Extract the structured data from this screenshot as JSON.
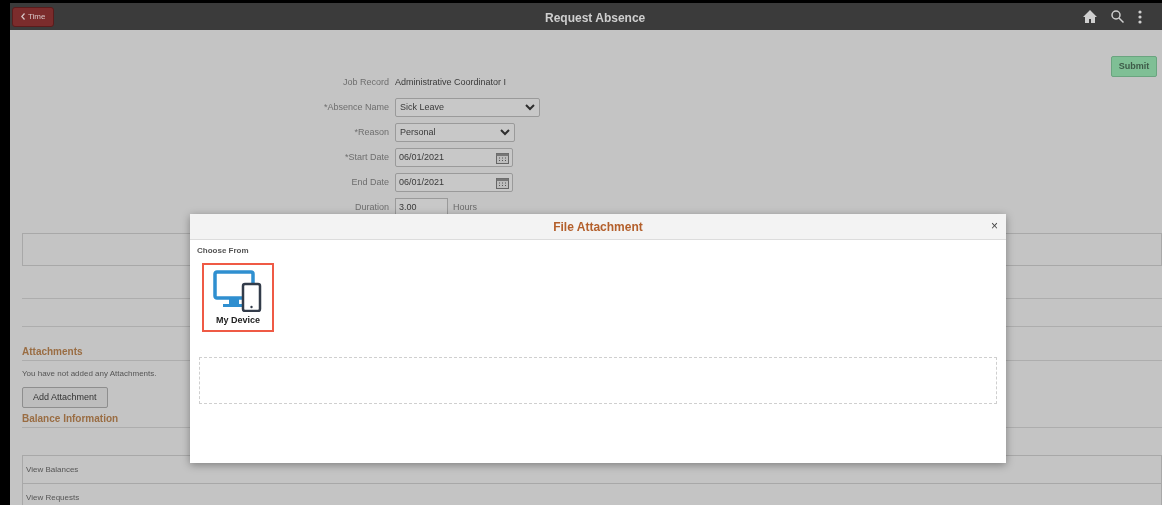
{
  "header": {
    "back_button": "Time",
    "title": "Request Absence"
  },
  "submit_button": "Submit",
  "form": {
    "fields": [
      {
        "label": "Job Record",
        "kind": "text",
        "value": "Administrative Coordinator I"
      },
      {
        "label": "*Absence Name",
        "kind": "select",
        "value": "Sick Leave"
      },
      {
        "label": "*Reason",
        "kind": "select",
        "value": "Personal"
      },
      {
        "label": "*Start Date",
        "kind": "date",
        "value": "06/01/2021"
      },
      {
        "label": "End Date",
        "kind": "date",
        "value": "06/01/2021"
      },
      {
        "label": "Duration",
        "kind": "number",
        "value": "3.00",
        "unit": "Hours"
      }
    ]
  },
  "attachments": {
    "heading": "Attachments",
    "message": "You have not added any Attachments.",
    "button": "Add Attachment"
  },
  "balance": {
    "heading": "Balance Information",
    "rows": [
      "View Balances",
      "View Requests"
    ]
  },
  "modal": {
    "title": "File Attachment",
    "close": "×",
    "section": "Choose From",
    "sources": [
      {
        "label": "My Device",
        "selected": true
      }
    ]
  }
}
